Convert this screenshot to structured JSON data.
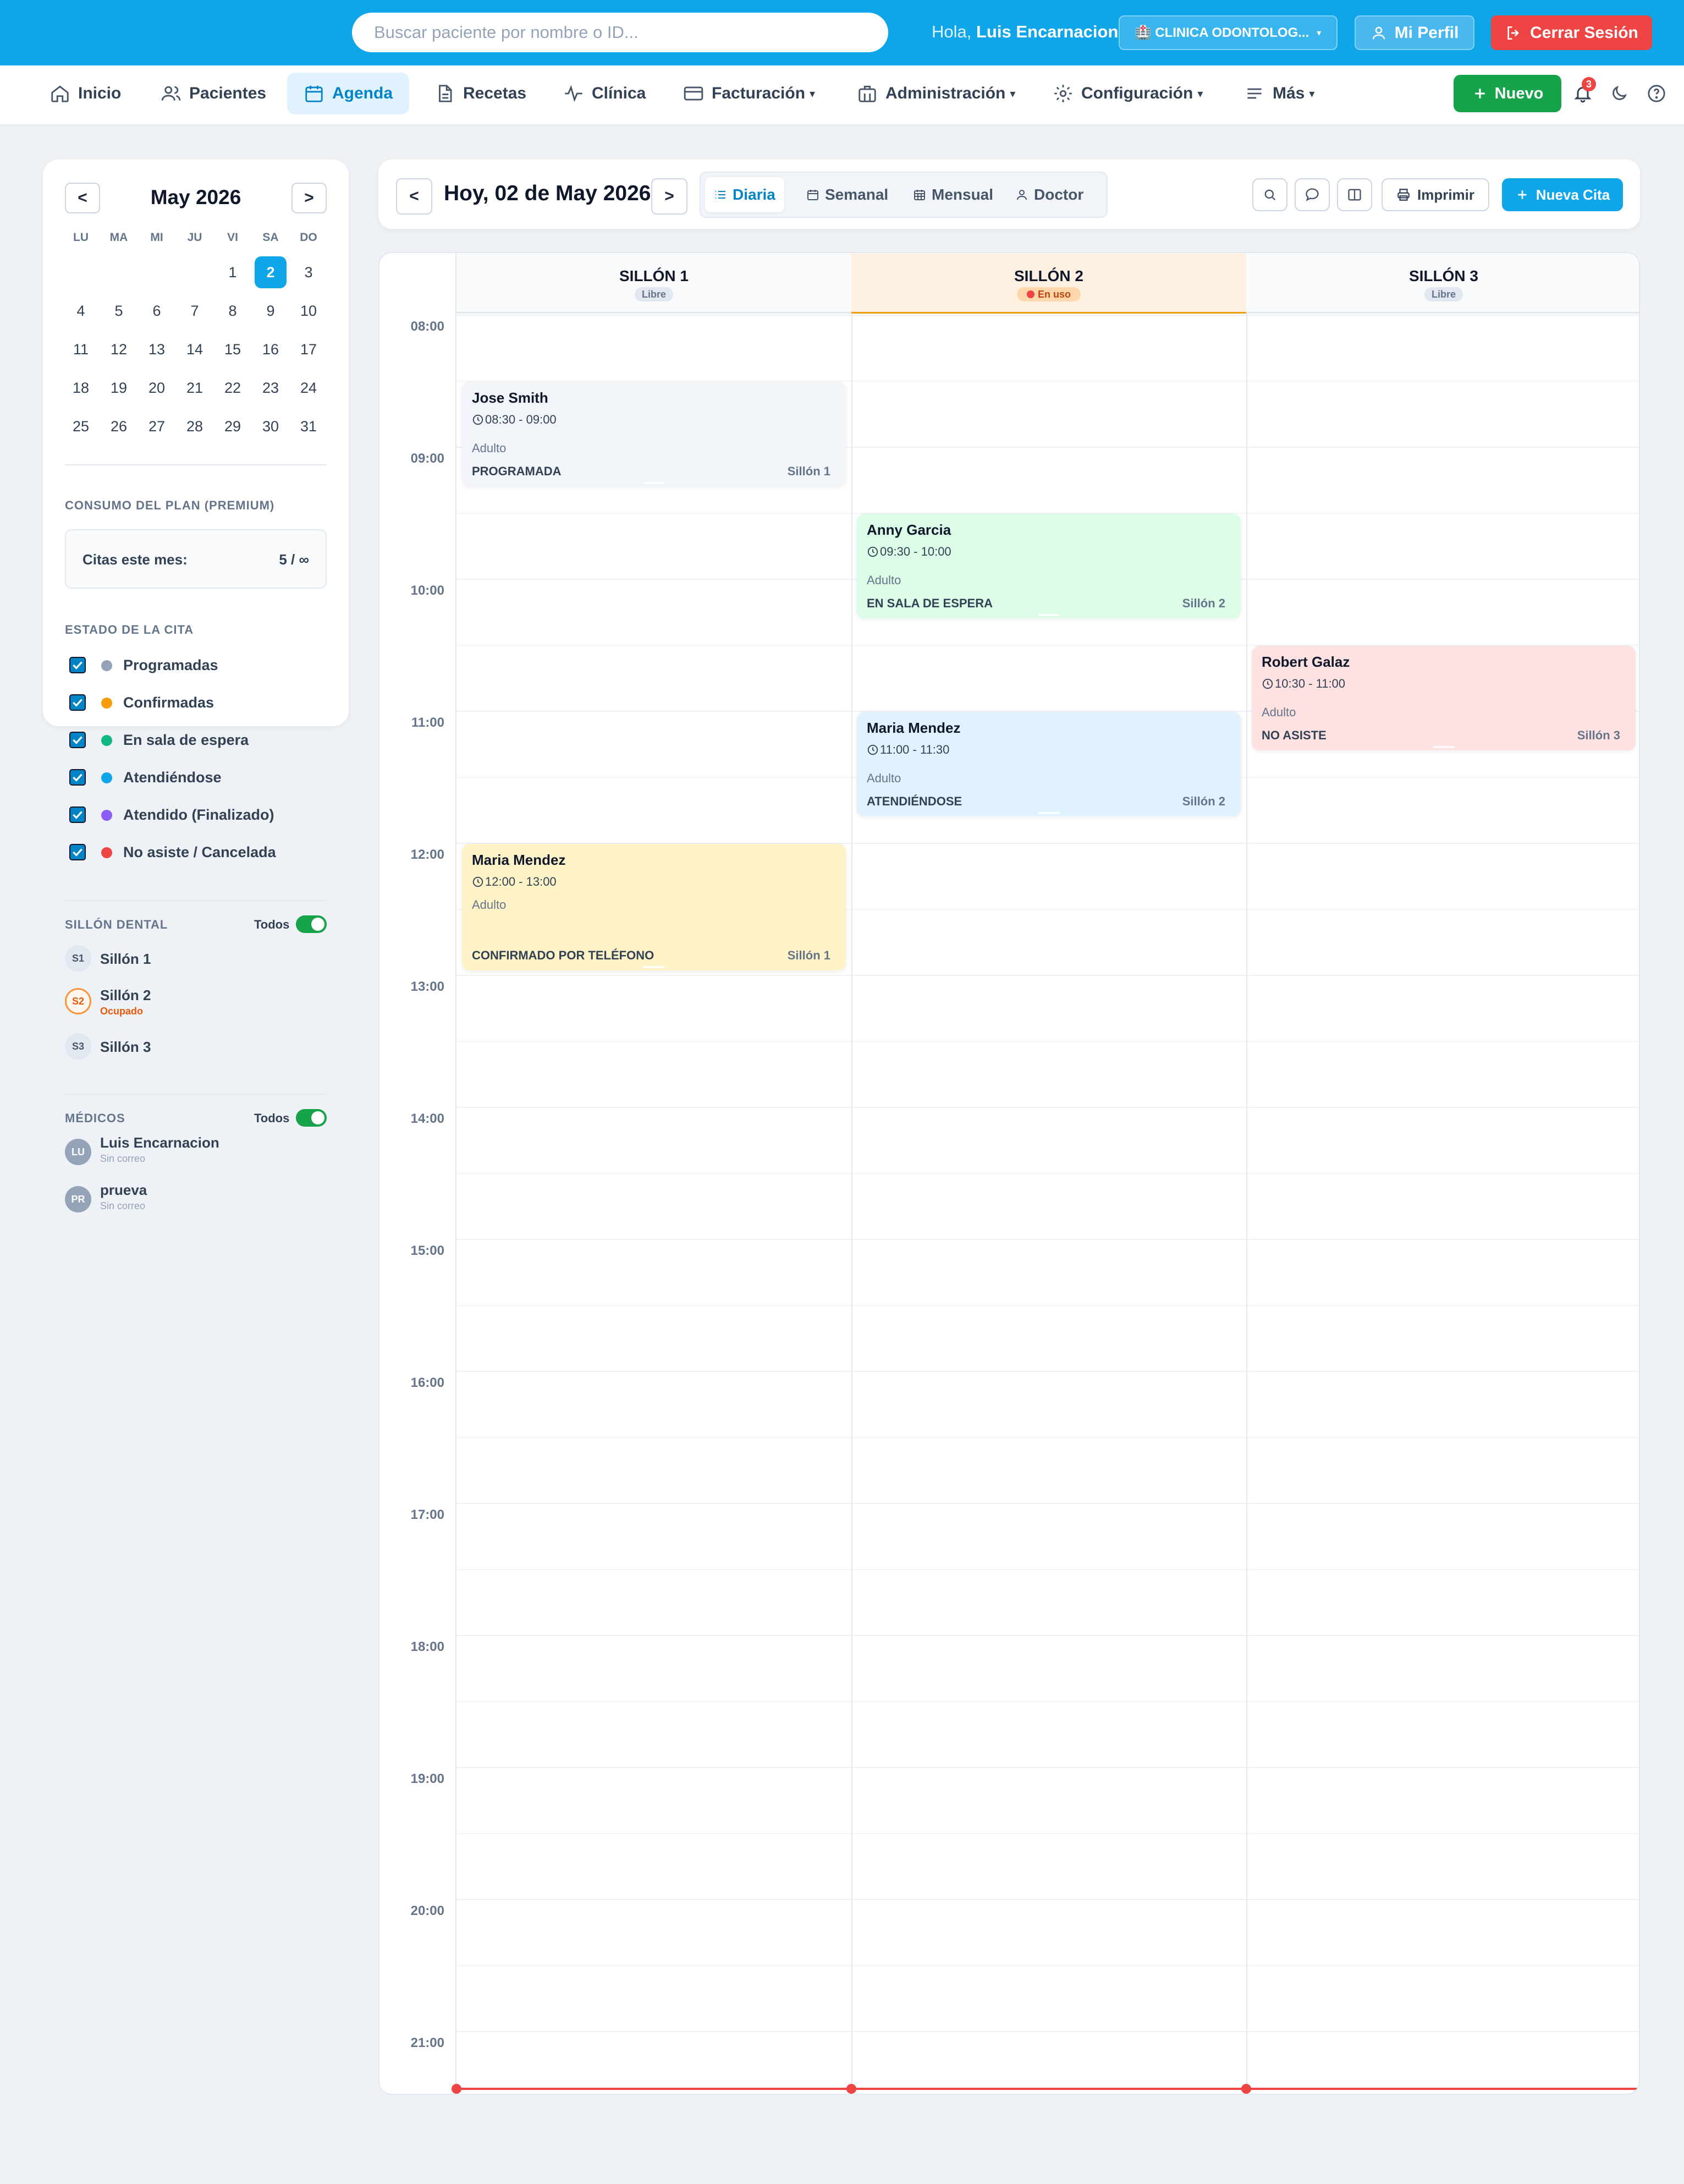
{
  "topbar": {
    "search_placeholder": "Buscar paciente por nombre o ID...",
    "greeting_prefix": "Hola,",
    "user_name": "Luis Encarnacion",
    "clinic_label": "🏥 CLINICA ODONTOLOG...",
    "profile_label": "Mi Perfil",
    "logout_label": "Cerrar Sesión"
  },
  "nav": {
    "items": [
      {
        "label": "Inicio",
        "icon": "home-icon"
      },
      {
        "label": "Pacientes",
        "icon": "users-icon"
      },
      {
        "label": "Agenda",
        "icon": "calendar-icon",
        "active": true
      },
      {
        "label": "Recetas",
        "icon": "document-icon"
      },
      {
        "label": "Clínica",
        "icon": "pulse-icon"
      },
      {
        "label": "Facturación",
        "icon": "credit-card-icon",
        "dropdown": true
      },
      {
        "label": "Administración",
        "icon": "briefcase-icon",
        "dropdown": true
      },
      {
        "label": "Configuración",
        "icon": "gear-icon",
        "dropdown": true
      },
      {
        "label": "Más",
        "icon": "menu-icon",
        "dropdown": true
      }
    ],
    "new_label": "Nuevo",
    "notification_count": "3"
  },
  "sidebar": {
    "calendar": {
      "prev": "<",
      "next": ">",
      "month_label": "May 2026",
      "weekdays": [
        "LU",
        "MA",
        "MI",
        "JU",
        "VI",
        "SA",
        "DO"
      ],
      "weeks": [
        [
          "",
          "",
          "",
          "",
          "1",
          "2",
          "3"
        ],
        [
          "4",
          "5",
          "6",
          "7",
          "8",
          "9",
          "10"
        ],
        [
          "11",
          "12",
          "13",
          "14",
          "15",
          "16",
          "17"
        ],
        [
          "18",
          "19",
          "20",
          "21",
          "22",
          "23",
          "24"
        ],
        [
          "25",
          "26",
          "27",
          "28",
          "29",
          "30",
          "31"
        ]
      ],
      "selected_day": "2"
    },
    "plan": {
      "title": "CONSUMO DEL PLAN (PREMIUM)",
      "label": "Citas este mes:",
      "value": "5 / ∞"
    },
    "status": {
      "title": "ESTADO DE LA CITA",
      "items": [
        {
          "label": "Programadas",
          "color": "#94a3b8",
          "checked": true
        },
        {
          "label": "Confirmadas",
          "color": "#f59e0b",
          "checked": true
        },
        {
          "label": "En sala de espera",
          "color": "#10b981",
          "checked": true
        },
        {
          "label": "Atendiéndose",
          "color": "#0ea5e9",
          "checked": true
        },
        {
          "label": "Atendido (Finalizado)",
          "color": "#8b5cf6",
          "checked": true
        },
        {
          "label": "No asiste / Cancelada",
          "color": "#ef4444",
          "checked": true
        }
      ]
    },
    "chairs": {
      "title": "SILLÓN DENTAL",
      "toggle_label": "Todos",
      "items": [
        {
          "abbr": "S1",
          "label": "Sillón 1",
          "sub": ""
        },
        {
          "abbr": "S2",
          "label": "Sillón 2",
          "sub": "Ocupado"
        },
        {
          "abbr": "S3",
          "label": "Sillón 3",
          "sub": ""
        }
      ]
    },
    "doctors": {
      "title": "MÉDICOS",
      "toggle_label": "Todos",
      "items": [
        {
          "abbr": "LU",
          "label": "Luis Encarnacion",
          "sub": "Sin correo"
        },
        {
          "abbr": "PR",
          "label": "prueva",
          "sub": "Sin correo"
        }
      ]
    }
  },
  "header": {
    "prev": "<",
    "next": ">",
    "date_title": "Hoy, 02 de May 2026",
    "views": [
      {
        "label": "Diaria",
        "icon": "list-icon",
        "active": true
      },
      {
        "label": "Semanal",
        "icon": "calendar-icon"
      },
      {
        "label": "Mensual",
        "icon": "calendar-grid-icon"
      },
      {
        "label": "Doctor",
        "icon": "user-icon"
      }
    ],
    "print_label": "Imprimir",
    "new_appt_label": "Nueva Cita"
  },
  "schedule": {
    "hours": [
      "08:00",
      "09:00",
      "10:00",
      "11:00",
      "12:00",
      "13:00",
      "14:00",
      "15:00",
      "16:00",
      "17:00",
      "18:00",
      "19:00",
      "20:00",
      "21:00"
    ],
    "columns": [
      {
        "title": "SILLÓN 1",
        "badge": "Libre",
        "busy": false
      },
      {
        "title": "SILLÓN 2",
        "badge": "En uso",
        "busy": true
      },
      {
        "title": "SILLÓN 3",
        "badge": "Libre",
        "busy": false
      }
    ],
    "appointments": [
      {
        "name": "Jose Smith",
        "time": "08:30 - 09:00",
        "type": "Adulto",
        "status": "PROGRAMADA",
        "chair": "Sillón 1",
        "column": 0,
        "start": "08:30",
        "end": "09:20",
        "bg": "#f1f5f9"
      },
      {
        "name": "Anny Garcia",
        "time": "09:30 - 10:00",
        "type": "Adulto",
        "status": "EN SALA DE ESPERA",
        "chair": "Sillón 2",
        "column": 1,
        "start": "09:30",
        "end": "10:20",
        "bg": "#dcfce7"
      },
      {
        "name": "Robert Galaz",
        "time": "10:30 - 11:00",
        "type": "Adulto",
        "status": "NO ASISTE",
        "chair": "Sillón 3",
        "column": 2,
        "start": "10:30",
        "end": "11:20",
        "bg": "#fee2e2"
      },
      {
        "name": "Maria Mendez",
        "time": "11:00 - 11:30",
        "type": "Adulto",
        "status": "ATENDIÉNDOSE",
        "chair": "Sillón 2",
        "column": 1,
        "start": "11:00",
        "end": "11:50",
        "bg": "#e0f2fe"
      },
      {
        "name": "Maria Mendez",
        "time": "12:00 - 13:00",
        "type": "Adulto",
        "status": "CONFIRMADO POR TELÉFONO",
        "chair": "Sillón 1",
        "column": 0,
        "start": "12:00",
        "end": "13:00",
        "bg": "#fef3c7"
      }
    ]
  }
}
